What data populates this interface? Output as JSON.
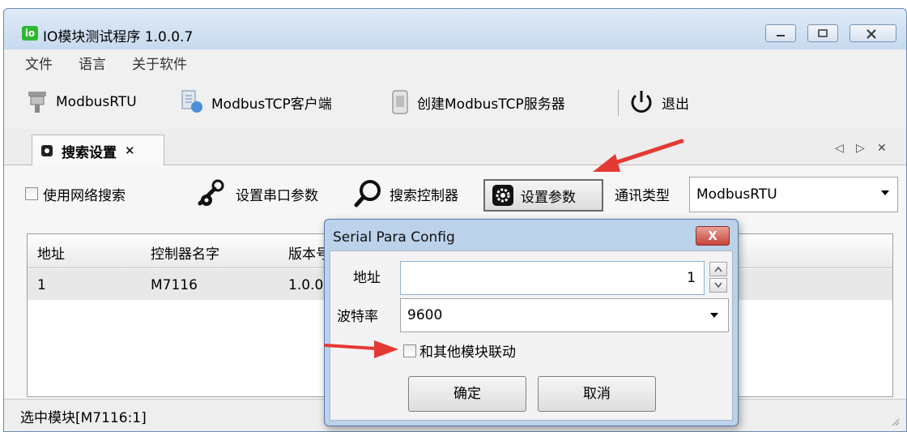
{
  "window": {
    "title": "IO模块测试程序 1.0.0.7",
    "app_icon_glyph": "io"
  },
  "menu": {
    "items": [
      "文件",
      "语言",
      "关于软件"
    ]
  },
  "toolbar": {
    "modbus_rtu": "ModbusRTU",
    "modbus_tcp_client": "ModbusTCP客户端",
    "create_tcp_server": "创建ModbusTCP服务器",
    "exit": "退出"
  },
  "tab": {
    "label": "搜索设置",
    "close_glyph": "✕",
    "nav_left": "◁",
    "nav_right": "▷",
    "strip_close": "✕"
  },
  "controls": {
    "use_network_search": "使用网络搜索",
    "set_serial_params": "设置串口参数",
    "search_controller": "搜索控制器",
    "set_params": "设置参数",
    "comm_type_label": "通讯类型",
    "comm_type_value": "ModbusRTU"
  },
  "grid": {
    "columns": [
      "地址",
      "控制器名字",
      "版本号"
    ],
    "rows": [
      {
        "address": "1",
        "name": "M7116",
        "version": "1.0.0"
      }
    ]
  },
  "status": {
    "text": "选中模块[M7116:1]"
  },
  "dialog": {
    "title": "Serial Para Config",
    "close_glyph": "X",
    "address_label": "地址",
    "address_value": "1",
    "baud_label": "波特率",
    "baud_value": "9600",
    "link_checkbox_label": "和其他模块联动",
    "ok": "确定",
    "cancel": "取消"
  },
  "colors": {
    "annotation_arrow": "#e53935",
    "titlebar": "#cfe0f1",
    "dialog_frame": "#bcd1ea"
  }
}
